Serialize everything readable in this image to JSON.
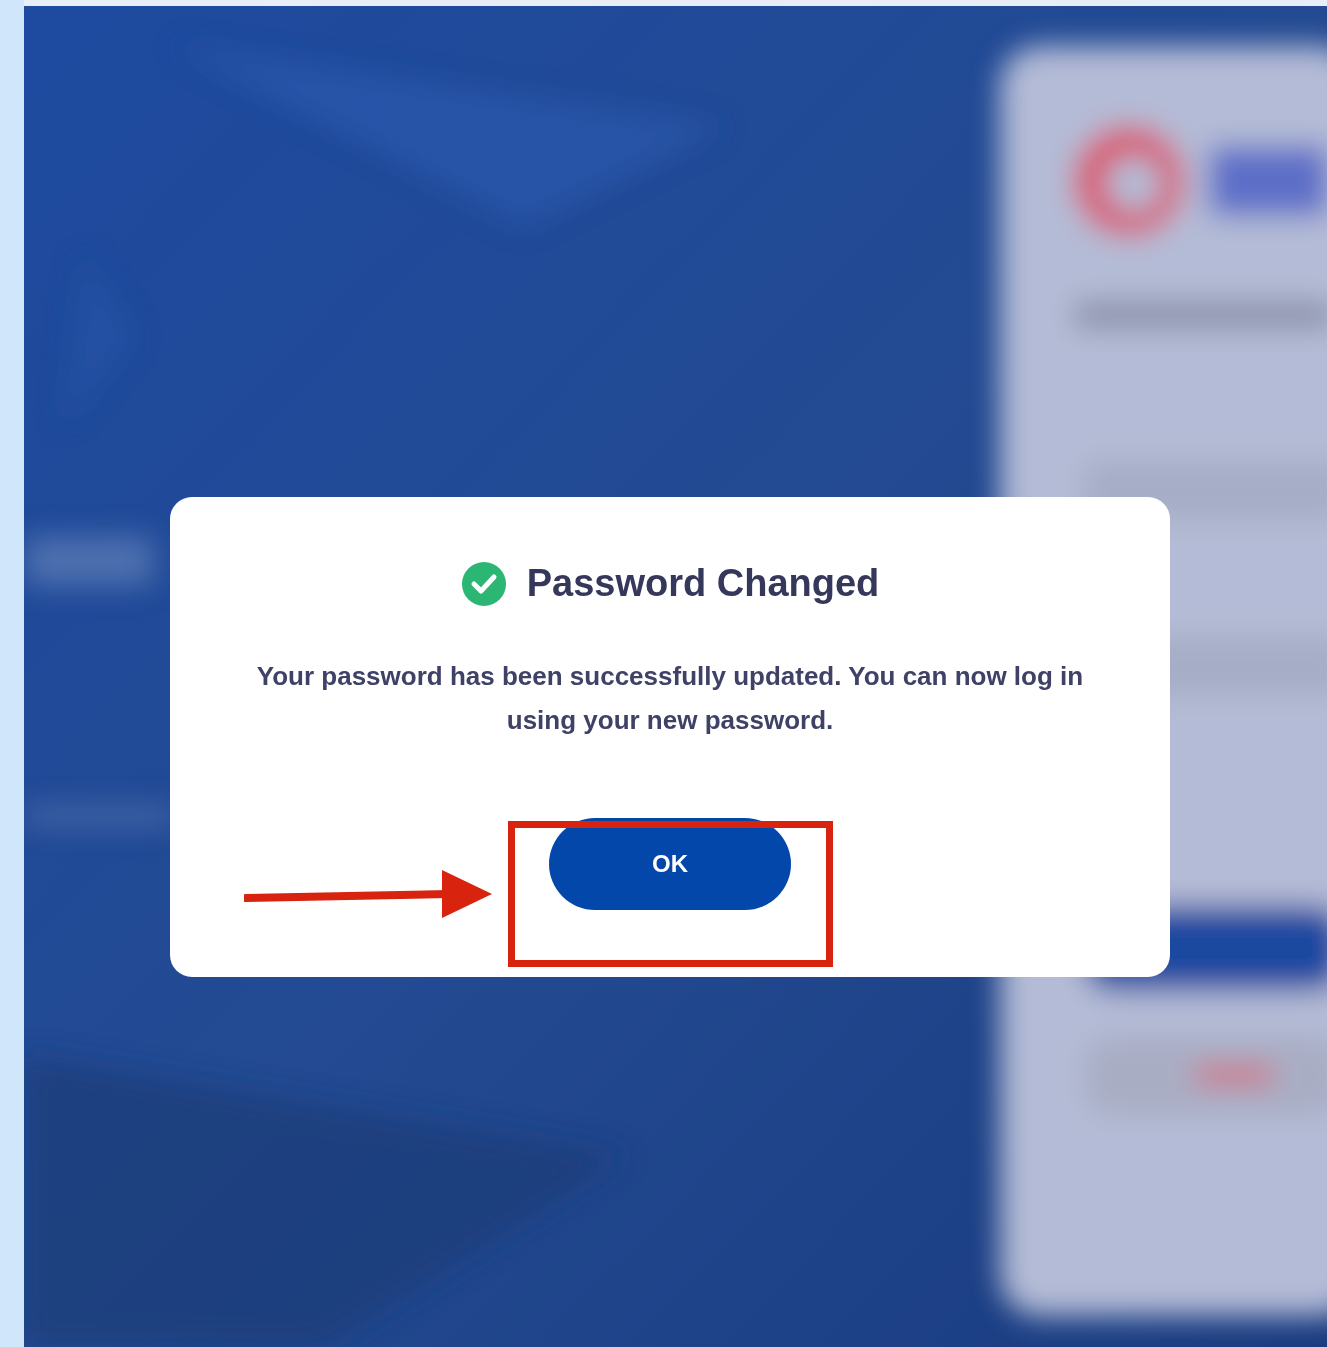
{
  "dialog": {
    "title": "Password Changed",
    "message": "Your password has been successfully updated. You can now log in using your new password.",
    "button": {
      "label": "OK"
    }
  }
}
